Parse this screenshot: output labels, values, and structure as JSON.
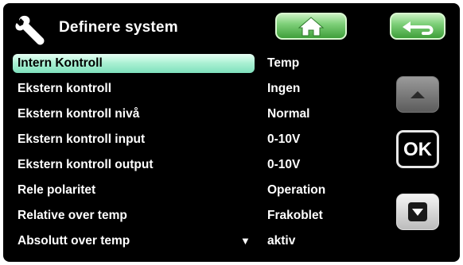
{
  "header": {
    "title": "Definere system",
    "icon": "wrench-icon",
    "home_icon": "home-icon",
    "back_icon": "back-arrow-icon"
  },
  "list": {
    "rows": [
      {
        "label": "Intern Kontroll",
        "value": "Temp",
        "selected": true
      },
      {
        "label": "Ekstern kontroll",
        "value": "Ingen",
        "selected": false
      },
      {
        "label": "Ekstern kontroll nivå",
        "value": "Normal",
        "selected": false
      },
      {
        "label": "Ekstern kontroll input",
        "value": "0-10V",
        "selected": false
      },
      {
        "label": "Ekstern kontroll output",
        "value": "0-10V",
        "selected": false
      },
      {
        "label": "Rele polaritet",
        "value": "Operation",
        "selected": false
      },
      {
        "label": "Relative over temp",
        "value": "Frakoblet",
        "selected": false
      },
      {
        "label": "Absolutt over temp",
        "value": "aktiv",
        "selected": false
      }
    ],
    "more_indicator": "▼"
  },
  "side": {
    "up_icon": "up-arrow-icon",
    "ok_label": "OK",
    "down_icon": "down-arrow-icon"
  },
  "colors": {
    "background": "#000000",
    "selection": "#a8f0d2",
    "header_button": "#5fbf5a"
  }
}
